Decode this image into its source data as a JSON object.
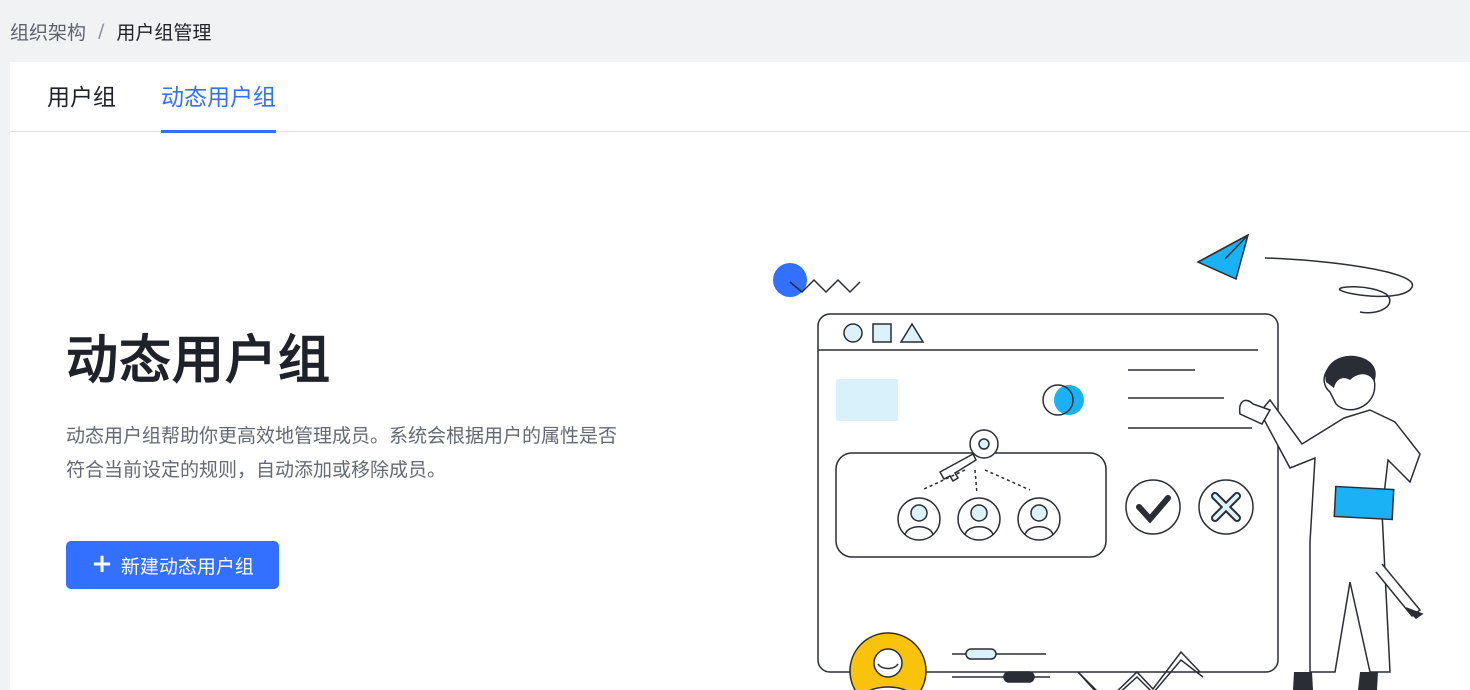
{
  "breadcrumb": {
    "parent": "组织架构",
    "separator": "/",
    "current": "用户组管理"
  },
  "tabs": [
    {
      "label": "用户组",
      "active": false
    },
    {
      "label": "动态用户组",
      "active": true
    }
  ],
  "hero": {
    "title": "动态用户组",
    "description": "动态用户组帮助你更高效地管理成员。系统会根据用户的属性是否符合当前设定的规则，自动添加或移除成员。",
    "create_button": {
      "icon": "plus-icon",
      "label": "新建动态用户组"
    }
  },
  "colors": {
    "accent": "#3370ff",
    "text": "#1f2329",
    "muted": "#646a73",
    "illus_blue": "#1ab2f5",
    "illus_yellow": "#f9c20b"
  }
}
